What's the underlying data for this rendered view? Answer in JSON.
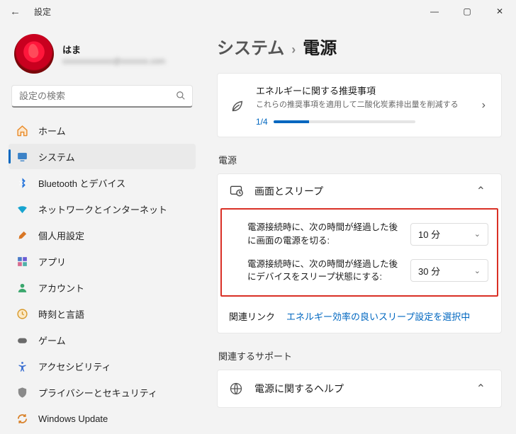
{
  "window": {
    "title": "設定"
  },
  "profile": {
    "name": "はま",
    "email": "xxxxxxxxxxxxx@xxxxxxx.com"
  },
  "search": {
    "placeholder": "設定の検索"
  },
  "nav": [
    {
      "label": "ホーム"
    },
    {
      "label": "システム"
    },
    {
      "label": "Bluetooth とデバイス"
    },
    {
      "label": "ネットワークとインターネット"
    },
    {
      "label": "個人用設定"
    },
    {
      "label": "アプリ"
    },
    {
      "label": "アカウント"
    },
    {
      "label": "時刻と言語"
    },
    {
      "label": "ゲーム"
    },
    {
      "label": "アクセシビリティ"
    },
    {
      "label": "プライバシーとセキュリティ"
    },
    {
      "label": "Windows Update"
    }
  ],
  "breadcrumb": {
    "parent": "システム",
    "sep": "›",
    "current": "電源"
  },
  "energy": {
    "title": "エネルギーに関する推奨事項",
    "desc": "これらの推奨事項を適用して二酸化炭素排出量を削減する",
    "progress_label": "1/4"
  },
  "sections": {
    "power": "電源",
    "support": "関連するサポート"
  },
  "screen_sleep": {
    "title": "画面とスリープ",
    "opt1_label": "電源接続時に、次の時間が経過した後に画面の電源を切る:",
    "opt1_value": "10 分",
    "opt2_label": "電源接続時に、次の時間が経過した後にデバイスをスリープ状態にする:",
    "opt2_value": "30 分"
  },
  "related": {
    "label": "関連リンク",
    "link": "エネルギー効率の良いスリープ設定を選択中"
  },
  "help": {
    "title": "電源に関するヘルプ"
  }
}
